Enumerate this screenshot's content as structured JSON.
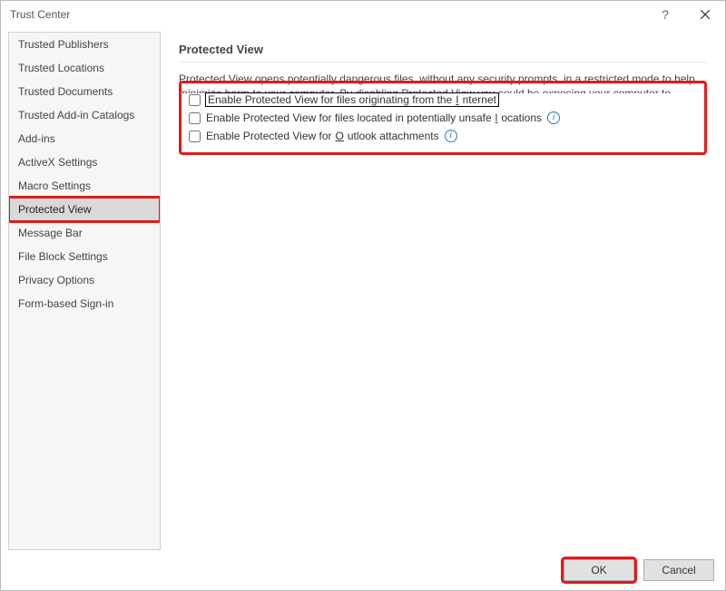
{
  "window": {
    "title": "Trust Center"
  },
  "sidebar": {
    "items": [
      {
        "label": "Trusted Publishers"
      },
      {
        "label": "Trusted Locations"
      },
      {
        "label": "Trusted Documents"
      },
      {
        "label": "Trusted Add-in Catalogs"
      },
      {
        "label": "Add-ins"
      },
      {
        "label": "ActiveX Settings"
      },
      {
        "label": "Macro Settings"
      },
      {
        "label": "Protected View",
        "selected": true
      },
      {
        "label": "Message Bar"
      },
      {
        "label": "File Block Settings"
      },
      {
        "label": "Privacy Options"
      },
      {
        "label": "Form-based Sign-in"
      }
    ]
  },
  "main": {
    "section_title": "Protected View",
    "description": "Protected View opens potentially dangerous files, without any security prompts, in a restricted mode to help minimize harm to your computer. By disabling Protected View you could be exposing your computer to possible security threats.",
    "options": [
      {
        "prefix": "Enable Protected View for files originating from the ",
        "key": "I",
        "suffix": "nternet",
        "info": false,
        "focused": true
      },
      {
        "prefix": "Enable Protected View for files located in potentially unsafe ",
        "key": "l",
        "suffix": "ocations",
        "info": true,
        "focused": false
      },
      {
        "prefix": "Enable Protected View for ",
        "key": "O",
        "suffix": "utlook attachments",
        "info": true,
        "focused": false
      }
    ]
  },
  "footer": {
    "ok": "OK",
    "cancel": "Cancel"
  },
  "icons": {
    "help": "?",
    "close": "×",
    "info": "i"
  }
}
